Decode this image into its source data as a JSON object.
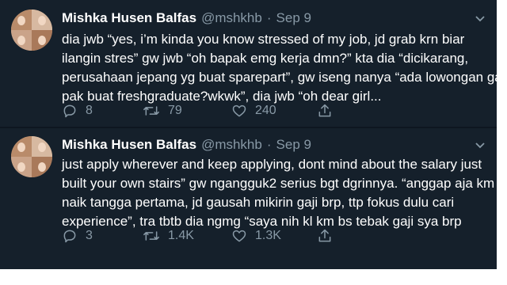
{
  "tweets": [
    {
      "author": {
        "name": "Mishka Husen Balfas",
        "handle": "@mshkhb",
        "separator": "·",
        "date": "Sep 9"
      },
      "text_lines": [
        "dia jwb “yes, i’m kinda you know stressed of my job, jd grab krn biar",
        "ilangin stres” gw jwb “oh bapak emg kerja dmn?” kta dia “dicikarang,",
        "perusahaan jepang yg buat sparepart”, gw iseng nanya “ada lowongan ga",
        "pak buat freshgraduate?wkwk”, dia jwb “oh dear girl..."
      ],
      "actions": {
        "replies": "8",
        "retweets": "79",
        "likes": "240"
      }
    },
    {
      "author": {
        "name": "Mishka Husen Balfas",
        "handle": "@mshkhb",
        "separator": "·",
        "date": "Sep 9"
      },
      "text_lines": [
        "just apply wherever and keep applying, dont mind about the salary just",
        "built your own stairs” gw ngangguk2 serius bgt dgrinnya. “anggap aja km",
        "naik tangga pertama, jd gausah mikirin gaji brp, ttp fokus dulu cari",
        "experience”, tra tbtb dia ngmg “saya nih kl km bs tebak gaji sya brp"
      ],
      "actions": {
        "replies": "3",
        "retweets": "1.4K",
        "likes": "1.3K"
      }
    }
  ],
  "icons": {
    "reply": "reply-icon",
    "retweet": "retweet-icon",
    "like": "heart-icon",
    "share": "share-icon",
    "more": "chevron-down-icon"
  },
  "colors": {
    "background": "#15202b",
    "text": "#ffffff",
    "muted": "#8899a6"
  }
}
